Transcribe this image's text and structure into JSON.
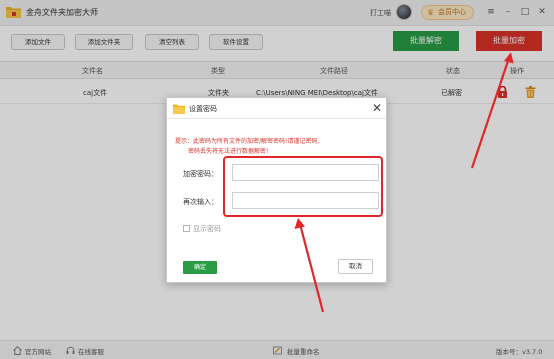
{
  "app": {
    "title": "金舟文件夹加密大师",
    "user_name": "打工喵",
    "vip_label": "会员中心"
  },
  "toolbar": {
    "add_file": "添加文件",
    "add_folder": "添加文件夹",
    "clear_list": "清空列表",
    "settings": "软件设置",
    "batch_decrypt": "批量解密",
    "batch_encrypt": "批量加密"
  },
  "table": {
    "headers": [
      "文件名",
      "类型",
      "文件路径",
      "状态",
      "操作"
    ],
    "rows": [
      {
        "name": "caj文件",
        "type": "文件夹",
        "path": "C:\\Users\\NING MEI\\Desktop\\caj文件",
        "status": "已解密"
      }
    ]
  },
  "dialog": {
    "title": "设置密码",
    "hint_line1": "提示：此密码为所有文件的加密/解密密码!请谨记密码,",
    "hint_line2": "密码丢失将无法进行数据解密!",
    "password_label": "加密密码：",
    "password_value": "",
    "confirm_label": "再次输入：",
    "confirm_value": "",
    "show_password_label": "显示密码",
    "ok_label": "确定",
    "cancel_label": "取消"
  },
  "statusbar": {
    "website": "官方网站",
    "support": "在线客服",
    "batch_rename": "批量重命名",
    "version": "版本号：v3.7.0"
  },
  "colors": {
    "green": "#2a9c46",
    "red": "#d9332a",
    "annotation": "#e0282a",
    "overlay": "rgba(0,0,0,0.18)"
  }
}
